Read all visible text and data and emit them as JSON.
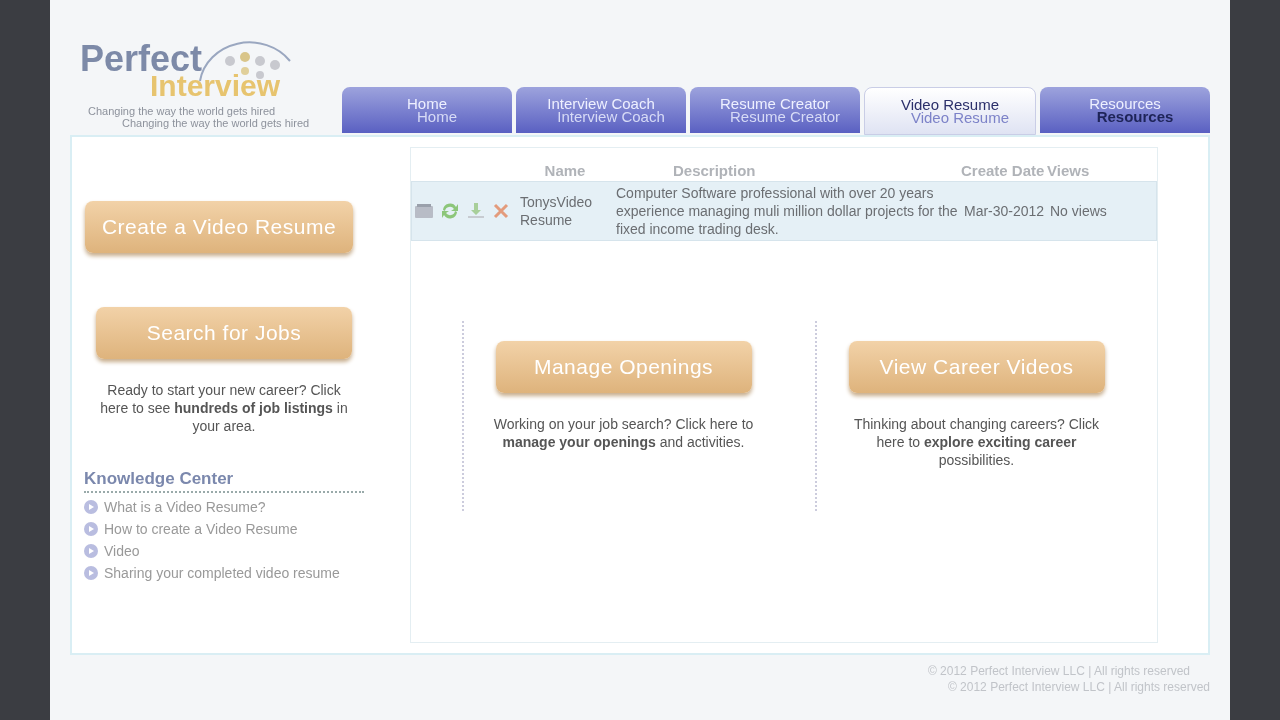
{
  "logo": {
    "word_1": "Perfect",
    "word_2": "Interview",
    "taglines": [
      "Changing the way the world gets hired",
      "Changing the way the world gets hired"
    ]
  },
  "tabs": [
    {
      "label": "Home",
      "ghost_label": "Home",
      "selected": false,
      "ghost_selected": false
    },
    {
      "label": "Interview Coach",
      "ghost_label": "Interview Coach",
      "selected": false,
      "ghost_selected": false
    },
    {
      "label": "Resume Creator",
      "ghost_label": "Resume Creator",
      "selected": false,
      "ghost_selected": false
    },
    {
      "label": "Video Resume",
      "ghost_label": "Video Resume",
      "selected": true,
      "ghost_selected": false
    },
    {
      "label": "Resources",
      "ghost_label": "Resources",
      "selected": false,
      "ghost_selected": true
    }
  ],
  "create_button": "Create a Video Resume",
  "table": {
    "columns": [
      "Name",
      "Description",
      "Create Date",
      "Views"
    ],
    "rows": [
      {
        "name": "TonysVideo Resume",
        "description": "Computer Software professional with over 20 years experience managing muli million dollar projects for the fixed income trading desk.",
        "create_date": "Mar-30-2012",
        "views": "No views"
      }
    ]
  },
  "actions": [
    {
      "button": "Search for Jobs",
      "text": "Ready to start your new career? Click here to see **hundreds of job listings** in your area."
    },
    {
      "button": "Manage Openings",
      "text": "Working on your job search? Click here to **manage your openings** and activities."
    },
    {
      "button": "View Career Videos",
      "text": "Thinking about changing careers? Click here to **explore exciting career** possibilities."
    }
  ],
  "knowledge_center": {
    "title": "Knowledge Center",
    "items": [
      "What is a Video Resume?",
      "How to create a Video Resume",
      "Video",
      "Sharing your completed video resume"
    ]
  },
  "footer": [
    "© 2012 Perfect Interview LLC | All rights reserved",
    "© 2012 Perfect Interview LLC | All rights reserved"
  ]
}
